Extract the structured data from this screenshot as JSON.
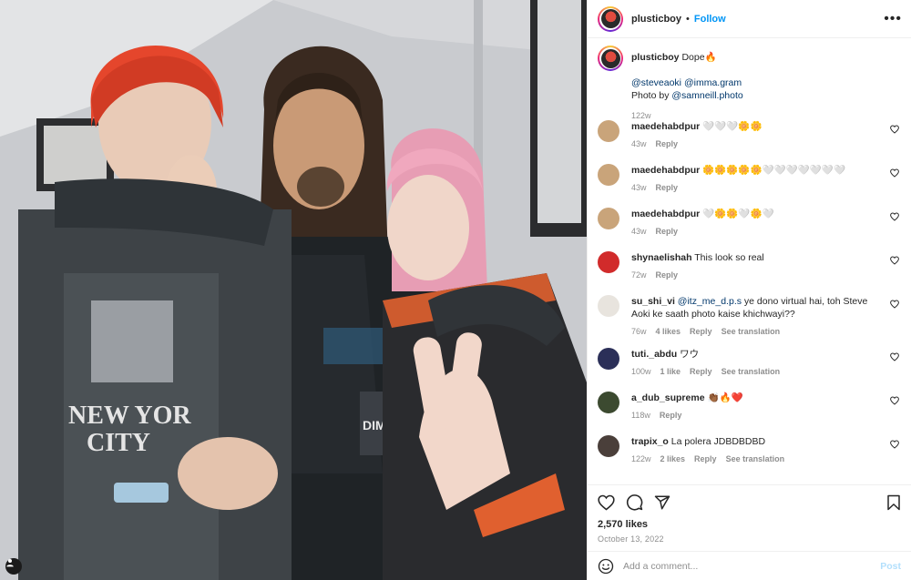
{
  "header": {
    "username": "plusticboy",
    "separator": "•",
    "follow_label": "Follow",
    "more_label": "•••"
  },
  "caption": {
    "username": "plusticboy",
    "text": "Dope🔥",
    "mention1": "@steveaoki",
    "mention2": "@imma.gram",
    "photo_by": "Photo by",
    "photo_mention": "@samneill.photo",
    "time": "122w"
  },
  "comments": [
    {
      "user": "maedehabdpur",
      "text": "🤍🤍🤍🌼🌼",
      "time": "43w",
      "likes": "",
      "reply": "Reply",
      "translate": "",
      "avatar_color": "#c9a47a"
    },
    {
      "user": "maedehabdpur",
      "text": "🌼🌼🌼🌼🌼🤍🤍🤍🤍🤍🤍🤍",
      "time": "43w",
      "likes": "",
      "reply": "Reply",
      "translate": "",
      "avatar_color": "#c9a47a"
    },
    {
      "user": "maedehabdpur",
      "text": "🤍🌼🌼🤍🌼🤍",
      "time": "43w",
      "likes": "",
      "reply": "Reply",
      "translate": "",
      "avatar_color": "#c9a47a"
    },
    {
      "user": "shynaelishah",
      "text": "This look so real",
      "time": "72w",
      "likes": "",
      "reply": "Reply",
      "translate": "",
      "avatar_color": "#d12b2b"
    },
    {
      "user": "su_shi_vi",
      "mention": "@itz_me_d.p.s",
      "text": "ye dono virtual hai, toh Steve Aoki ke saath photo kaise khichwayi??",
      "time": "76w",
      "likes": "4 likes",
      "reply": "Reply",
      "translate": "See translation",
      "avatar_color": "#e8e4de"
    },
    {
      "user": "tuti._abdu",
      "text": "ワウ",
      "time": "100w",
      "likes": "1 like",
      "reply": "Reply",
      "translate": "See translation",
      "avatar_color": "#2b2f58"
    },
    {
      "user": "a_dub_supreme",
      "text": "👏🏾🔥❤️",
      "time": "118w",
      "likes": "",
      "reply": "Reply",
      "translate": "",
      "avatar_color": "#3c4a30"
    },
    {
      "user": "trapix_o",
      "text": "La polera JDBDBDBD",
      "time": "122w",
      "likes": "2 likes",
      "reply": "Reply",
      "translate": "See translation",
      "avatar_color": "#4a3f3a"
    }
  ],
  "likes_text": "2,570 likes",
  "date_text": "October 13, 2022",
  "add_comment": {
    "placeholder": "Add a comment...",
    "post_label": "Post"
  },
  "colors": {
    "accent": "#0095f6",
    "mention": "#00376b",
    "muted": "#8e8e8e",
    "post_disabled": "#b2dffc"
  },
  "icons": [
    "heart-icon",
    "comment-icon",
    "share-icon",
    "bookmark-icon",
    "emoji-icon",
    "user-tag-icon",
    "more-icon"
  ]
}
